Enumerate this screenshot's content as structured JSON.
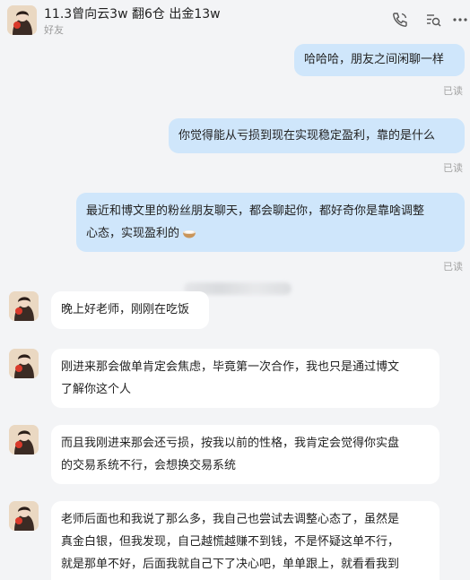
{
  "header": {
    "title": "11.3曾向云3w 翻6仓 出金13w",
    "subtitle": "好友",
    "icons": [
      "call-icon",
      "search-chat-icon",
      "more-icon"
    ]
  },
  "messages": [
    {
      "side": "out",
      "text": "哈哈哈，朋友之间闲聊一样",
      "status": "已读"
    },
    {
      "side": "out",
      "text": "你觉得能从亏损到现在实现稳定盈利，靠的是什么",
      "status": "已读"
    },
    {
      "side": "out",
      "line1": "最近和博文里的粉丝朋友聊天，都会聊起你，都好奇你是靠啥调整",
      "line2": "心态，实现盈利的",
      "emoji": "bowl-emoji",
      "status": "已读"
    },
    {
      "side": "in",
      "text": "晚上好老师，刚刚在吃饭"
    },
    {
      "side": "in",
      "line1": "刚进来那会做单肯定会焦虑，毕竟第一次合作，我也只是通过博文",
      "line2": "了解你这个人"
    },
    {
      "side": "in",
      "line1": "而且我刚进来那会还亏损，按我以前的性格，我肯定会觉得你实盘",
      "line2": "的交易系统不行，会想换交易系统"
    },
    {
      "side": "in",
      "line1": "老师后面也和我说了那么多，我自己也尝试去调整心态了，虽然是",
      "line2": "真金白银，但我发现，自己越慌越赚不到钱，不是怀疑这单不行，",
      "line3": "就是那单不好，后面我就自己下了决心吧，单单跟上，就看看我到"
    }
  ]
}
